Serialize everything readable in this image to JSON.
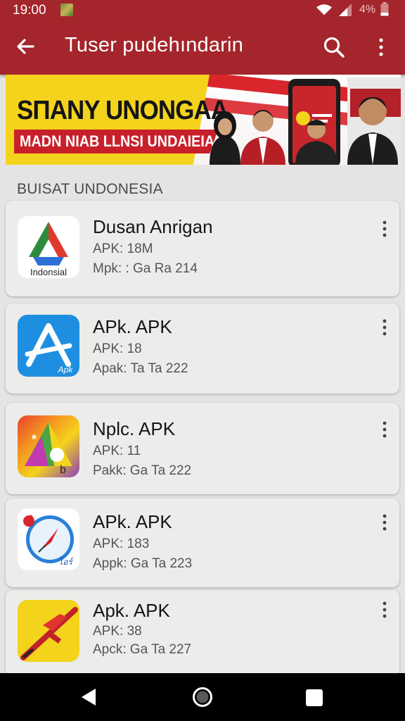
{
  "status_bar": {
    "time": "19:00",
    "battery_text": "4%",
    "icons": [
      "notification-thumbnail-icon",
      "wifi-icon",
      "signal-icon",
      "battery-icon"
    ]
  },
  "app_bar": {
    "title": "Tuser pudehındarin",
    "back_icon": "arrow-left-icon",
    "search_icon": "search-icon",
    "more_icon": "more-vert-icon"
  },
  "banner": {
    "headline": "SΠANY UNONGAA",
    "subline": "MADN  NIAB LLNSI UNDAIEIA"
  },
  "section": {
    "heading": "BUISAT UNDONESIA"
  },
  "apps": [
    {
      "name": "Dusan Anrigan",
      "line1": "APK: 18M",
      "line2": "Mpk: : Ga Ra 214",
      "icon_text": "Indonsial",
      "icon": "triangle-logo-icon"
    },
    {
      "name": "APk. APK",
      "line1": "APK: 18",
      "line2": "Apak:  Ta Ta 222",
      "icon_text": "Apk",
      "icon": "letter-a-icon"
    },
    {
      "name": "Nplc. APK",
      "line1": "APK: 11",
      "line2": "Pakk: Ga Ta 222",
      "icon_text": "",
      "icon": "colorful-triangle-icon"
    },
    {
      "name": "APk. APK",
      "line1": "APK: 183",
      "line2": "Appk: Ga Ta 223",
      "icon_text": "ไอร์",
      "icon": "compass-icon"
    },
    {
      "name": "Apk. APK",
      "line1": "APK: 38",
      "line2": "Apck: Ga Ta 227",
      "icon_text": "",
      "icon": "airplane-icon"
    }
  ],
  "nav_bar": {
    "buttons": [
      "nav-back-icon",
      "nav-home-icon",
      "nav-recents-icon"
    ]
  },
  "colors": {
    "app_bar": "#a4252b",
    "background": "#e6e4e3",
    "card": "#ececeb",
    "banner_yellow": "#f4d31c",
    "banner_red": "#c8202a"
  }
}
